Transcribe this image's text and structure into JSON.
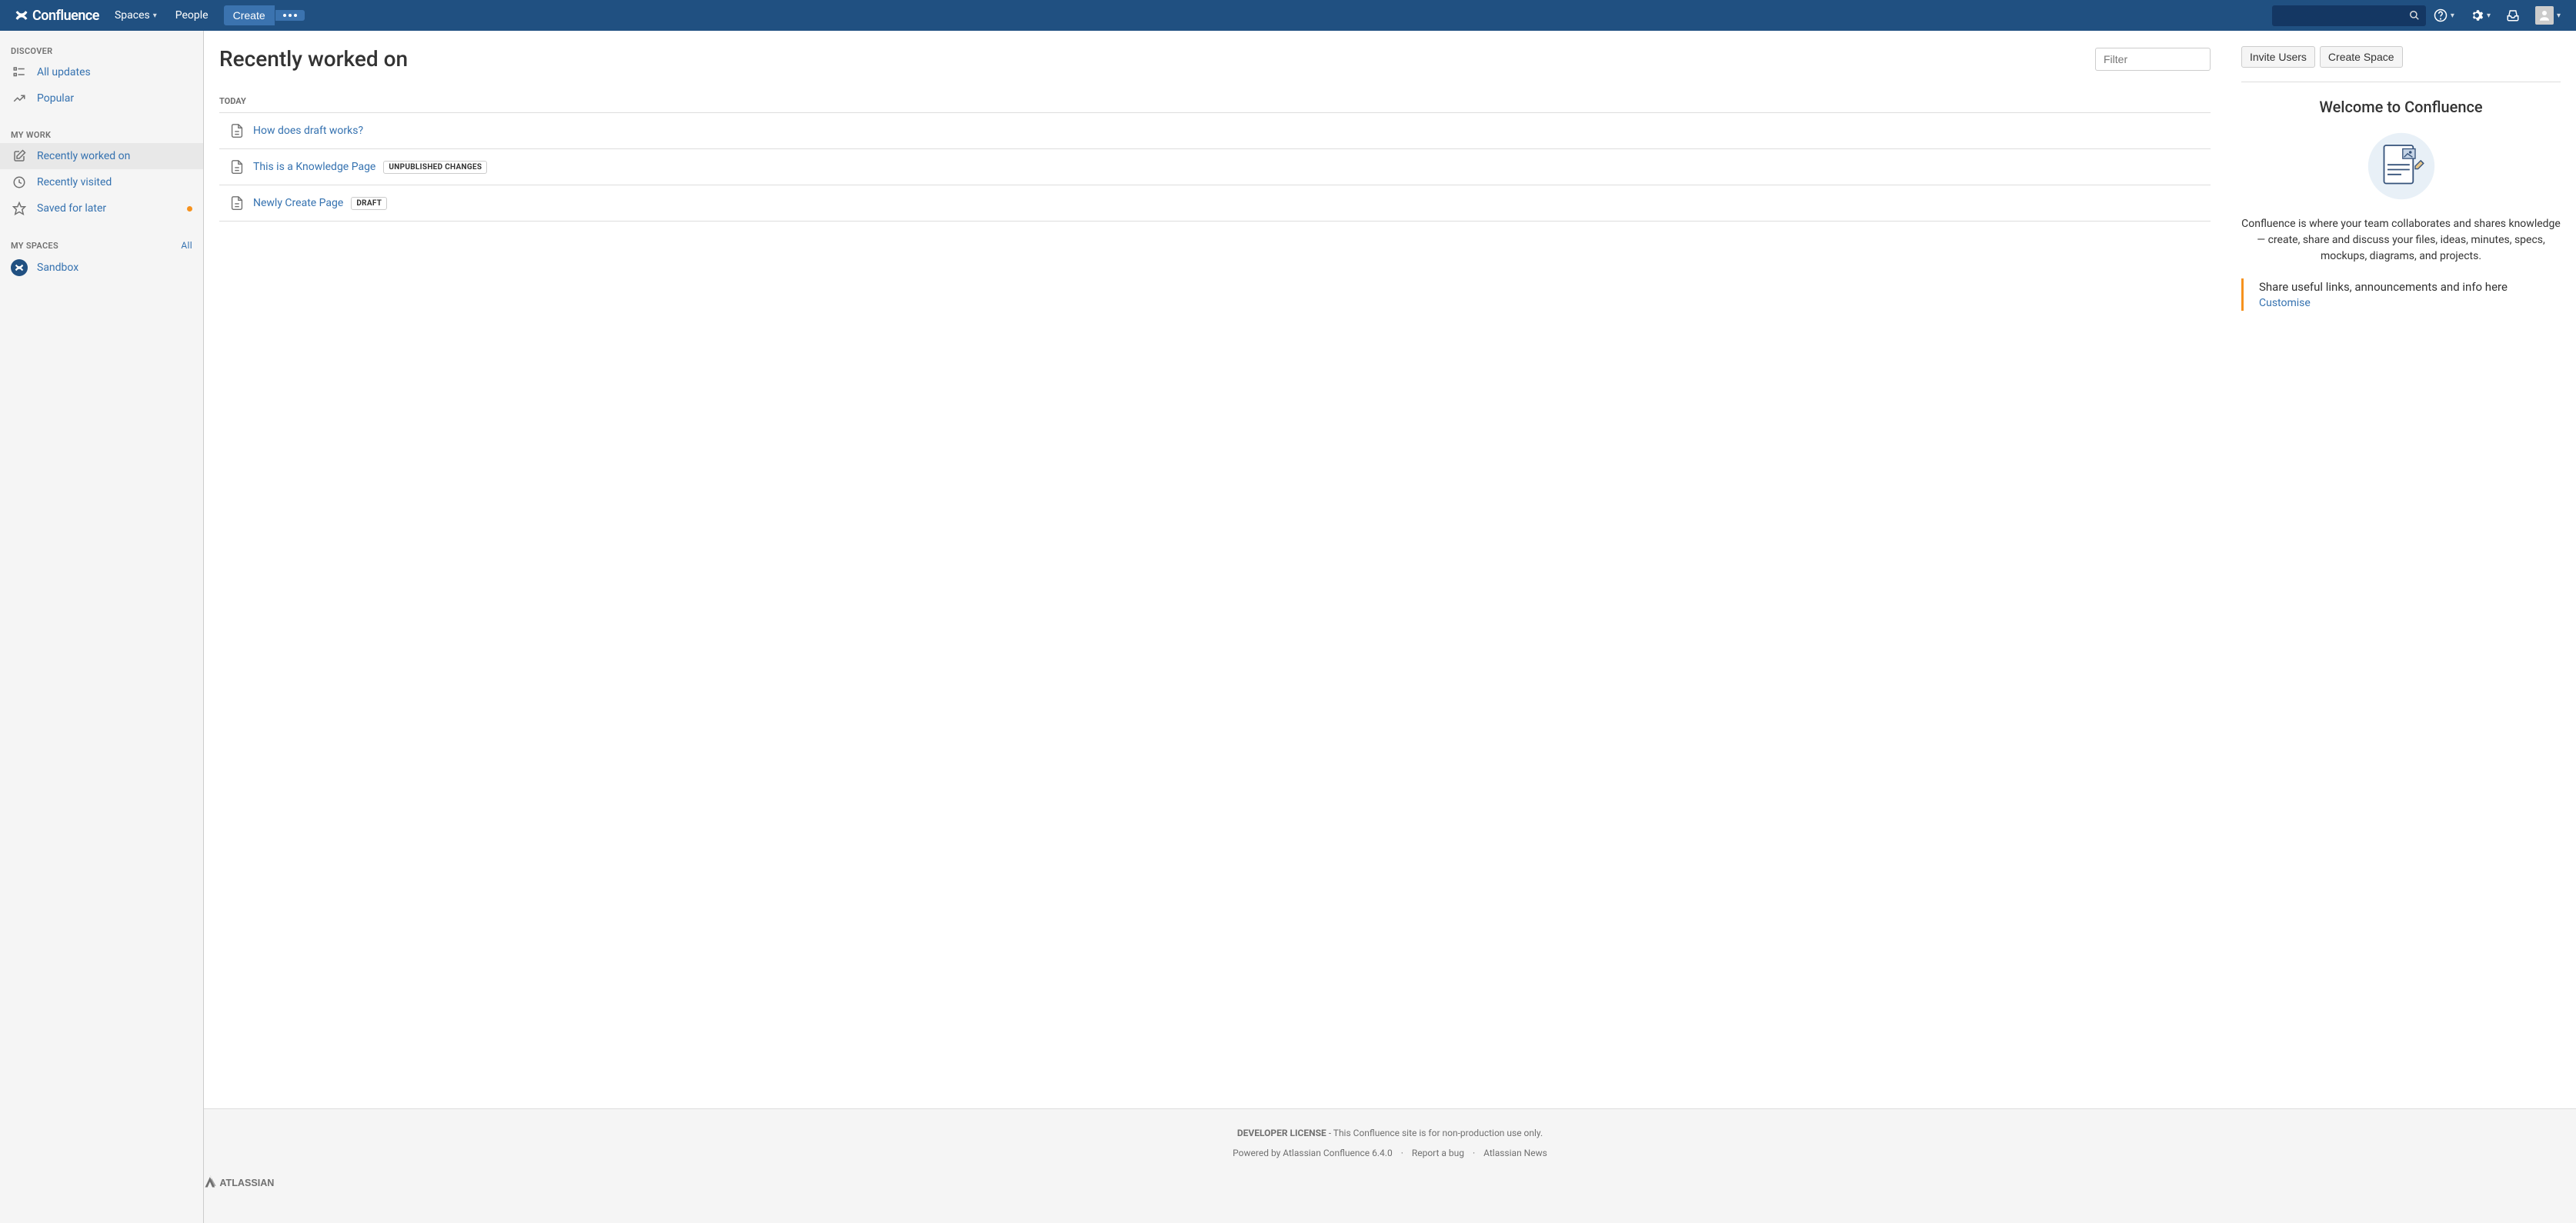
{
  "header": {
    "logo_text": "Confluence",
    "nav": {
      "spaces": "Spaces",
      "people": "People"
    },
    "create": "Create"
  },
  "sidebar": {
    "discover": {
      "heading": "DISCOVER",
      "all_updates": "All updates",
      "popular": "Popular"
    },
    "mywork": {
      "heading": "MY WORK",
      "recently_worked": "Recently worked on",
      "recently_visited": "Recently visited",
      "saved": "Saved for later"
    },
    "myspaces": {
      "heading": "MY SPACES",
      "all": "All",
      "sandbox": "Sandbox"
    }
  },
  "main": {
    "title": "Recently worked on",
    "filter_placeholder": "Filter",
    "group": "TODAY",
    "items": [
      {
        "title": "How does draft works?",
        "tag": ""
      },
      {
        "title": "This is a Knowledge Page",
        "tag": "UNPUBLISHED CHANGES"
      },
      {
        "title": "Newly Create Page",
        "tag": "DRAFT"
      }
    ]
  },
  "right": {
    "invite": "Invite Users",
    "create_space": "Create Space",
    "welcome_title": "Welcome to Confluence",
    "welcome_desc": "Confluence is where your team collaborates and shares knowledge — create, share and discuss your files, ideas, minutes, specs, mockups, diagrams, and projects.",
    "callout_text": "Share useful links, announcements and info here",
    "callout_link": "Customise"
  },
  "footer": {
    "license_bold": "DEVELOPER LICENSE",
    "license_rest": " - This Confluence site is for non-production use only.",
    "powered": "Powered by ",
    "product": "Atlassian Confluence",
    "version": " 6.4.0",
    "report": "Report a bug",
    "news": "Atlassian News",
    "brand": "Atlassian"
  }
}
